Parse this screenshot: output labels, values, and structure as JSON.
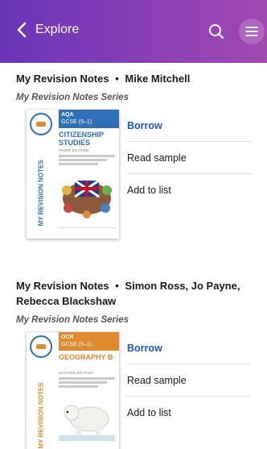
{
  "header": {
    "back_label": "Explore",
    "colors": {
      "gradient_start": "#6a35b8",
      "gradient_end": "#a049b0"
    }
  },
  "books": [
    {
      "series_title": "My Revision Notes",
      "separator": "•",
      "authors": "Mike Mitchell",
      "series_line": "My Revision Notes Series",
      "cover": {
        "board": "AQA",
        "level": "GCSE (9–1)",
        "title": "CITIZENSHIP STUDIES",
        "edition": "THIRD EDITION",
        "spine_text": "MY REVISION NOTES",
        "band_color": "#2f6fb7"
      },
      "actions": {
        "borrow": "Borrow",
        "sample": "Read sample",
        "add_list": "Add to list"
      }
    },
    {
      "series_title": "My Revision Notes",
      "separator": "•",
      "authors": "Simon Ross, Jo Payne, Rebecca Blackshaw",
      "series_line": "My Revision Notes Series",
      "cover": {
        "board": "OCR",
        "level": "GCSE (9–1)",
        "title": "GEOGRAPHY B",
        "edition": "SECOND EDITION",
        "spine_text": "MY REVISION NOTES",
        "band_color": "#e0892f"
      },
      "actions": {
        "borrow": "Borrow",
        "sample": "Read sample",
        "add_list": "Add to list"
      }
    }
  ]
}
